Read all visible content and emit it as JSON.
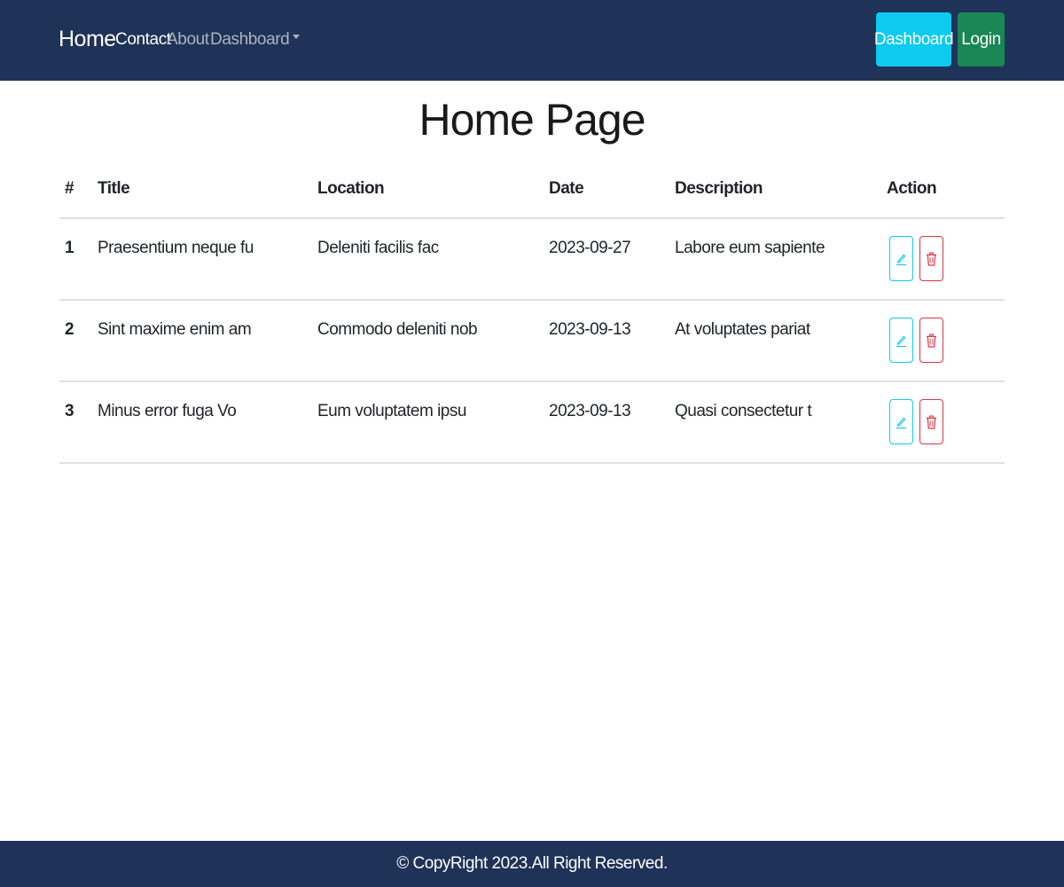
{
  "navbar": {
    "brand": "Home",
    "links": [
      "Contact",
      "About",
      "Dashboard"
    ],
    "dashboard_button": "Dashboard",
    "login_button": "Login"
  },
  "page": {
    "title": "Home Page"
  },
  "table": {
    "headers": [
      "#",
      "Title",
      "Location",
      "Date",
      "Description",
      "Action"
    ],
    "rows": [
      {
        "num": "1",
        "title": "Praesentium neque fu",
        "location": "Deleniti facilis fac",
        "date": "2023-09-27",
        "description": "Labore eum sapiente"
      },
      {
        "num": "2",
        "title": "Sint maxime enim am",
        "location": "Commodo deleniti nob",
        "date": "2023-09-13",
        "description": "At voluptates pariat"
      },
      {
        "num": "3",
        "title": "Minus error fuga Vo",
        "location": "Eum voluptatem ipsu",
        "date": "2023-09-13",
        "description": "Quasi consectetur t"
      }
    ],
    "action_icons": [
      "pencil-icon",
      "trash-icon"
    ]
  },
  "footer": {
    "text": "© CopyRight 2023.All Right Reserved."
  },
  "colors": {
    "navbar_bg": "#1f3257",
    "info": "#0dcaf0",
    "success": "#198754",
    "danger": "#dc3545"
  }
}
